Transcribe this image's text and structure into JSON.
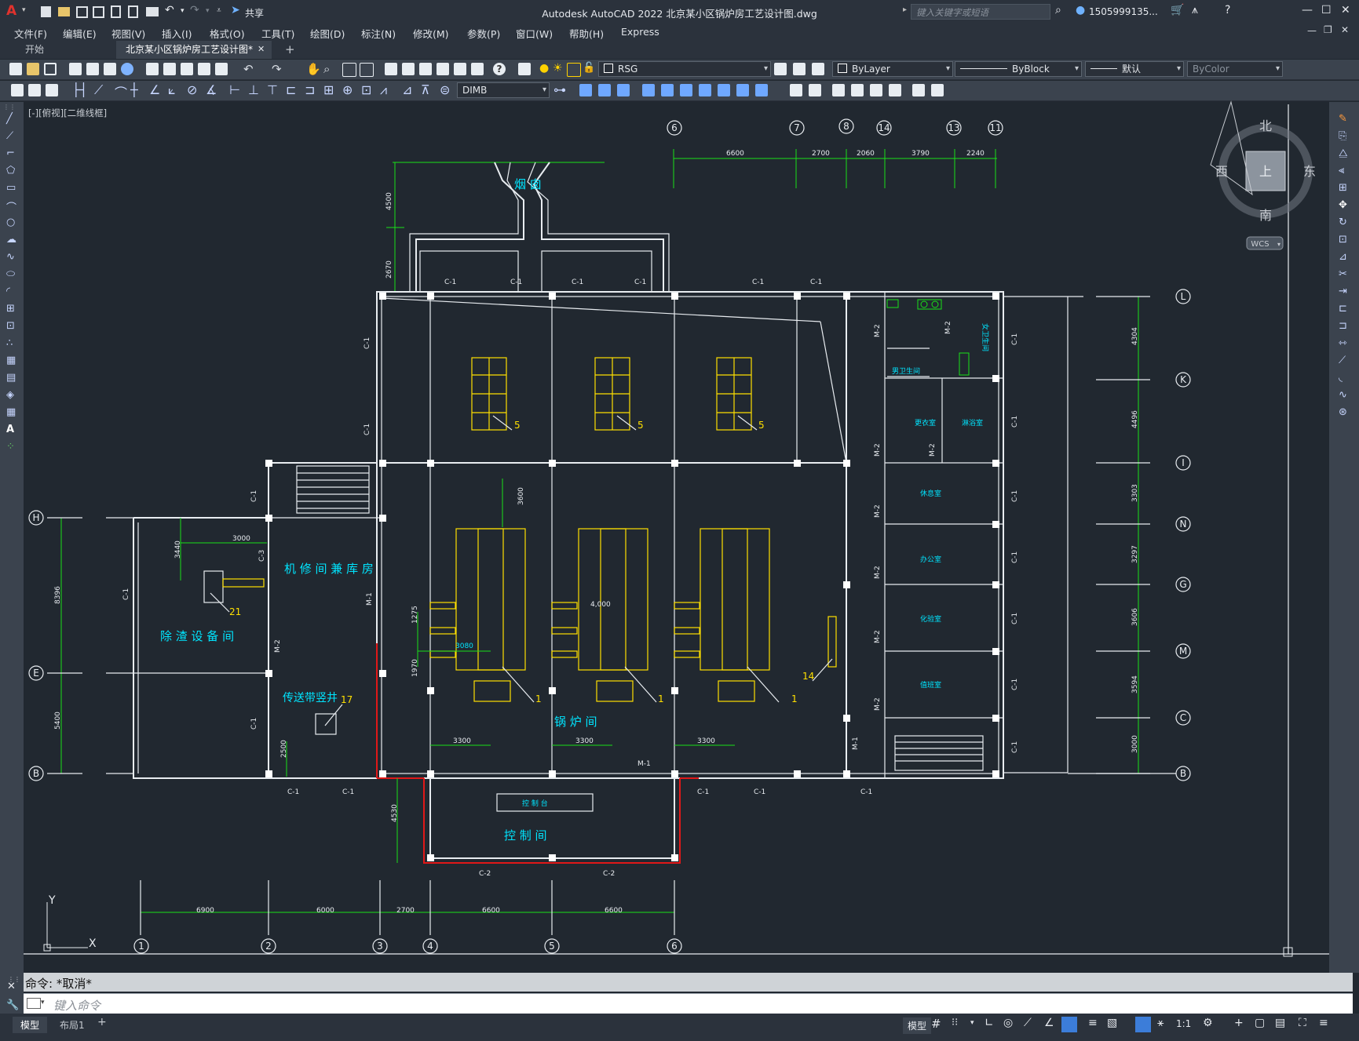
{
  "window": {
    "title": "Autodesk AutoCAD 2022    北京某小区锅炉房工艺设计图.dwg",
    "share_label": "共享",
    "search_placeholder": "键入关键字或短语",
    "user_name": "1505999135...",
    "min_label": "—",
    "max_label": "☐",
    "close_label": "✕"
  },
  "menu": {
    "items": [
      "文件(F)",
      "编辑(E)",
      "视图(V)",
      "插入(I)",
      "格式(O)",
      "工具(T)",
      "绘图(D)",
      "标注(N)",
      "修改(M)",
      "参数(P)",
      "窗口(W)",
      "帮助(H)",
      "Express"
    ]
  },
  "tabs": {
    "start": "开始",
    "active": "北京某小区锅炉房工艺设计图*",
    "close": "✕",
    "add": "+"
  },
  "toolbar": {
    "layer_value": "RSG",
    "color_value": "ByLayer",
    "linetype_value": "ByBlock",
    "lineweight_value": "默认",
    "plotstyle_value": "ByColor",
    "dimstyle_value": "DIMB"
  },
  "viewport": {
    "label": "[-][俯视][二维线框]",
    "compass": {
      "n": "北",
      "s": "南",
      "e": "东",
      "w": "西",
      "top": "上"
    },
    "wcs": "WCS",
    "ucs_y": "Y",
    "ucs_x": "X"
  },
  "drawing": {
    "top_axes": [
      "6",
      "7",
      "8",
      "14",
      "13",
      "11"
    ],
    "top_dims": [
      "6600",
      "2700",
      "2060",
      "3790",
      "2240"
    ],
    "bottom_axes": [
      "1",
      "2",
      "3",
      "4",
      "5",
      "6"
    ],
    "bottom_dims": [
      "6900",
      "6000",
      "2700",
      "6600",
      "6600"
    ],
    "left_axes": [
      "H",
      "E",
      "B"
    ],
    "left_dims": [
      "8396",
      "5400"
    ],
    "right_axes": [
      "L",
      "K",
      "I",
      "N",
      "G",
      "M",
      "C",
      "B"
    ],
    "right_dims": [
      "4304",
      "4496",
      "3303",
      "3297",
      "3606",
      "3594",
      "3000"
    ],
    "rooms": {
      "chimney": "烟 囱",
      "workshop": "机 修 间 兼 库 房",
      "dust_room": "除 渣 设 备 间",
      "conveyor": "传送带竖井",
      "boiler_room": "锅    炉    间",
      "control_room": "控     制     间",
      "console": "控  制  台",
      "changing": "更衣室",
      "bath": "淋浴室",
      "rest": "休息室",
      "office": "办公室",
      "lab": "化验室",
      "duty": "值班室",
      "toilet": "男卫生间",
      "toilet_f": "女卫生间"
    },
    "tags": {
      "c1": "C-1",
      "c2": "C-2",
      "c3": "C-3",
      "m1": "M-1",
      "m2": "M-2",
      "n5": "5",
      "n1": "1",
      "n14": "14",
      "n17": "17",
      "n21": "21",
      "d3000": "3000",
      "d3440": "3440",
      "d3300": "3300",
      "d4500": "4500",
      "d2670": "2670",
      "d3600": "3600",
      "d1275": "1275",
      "d3080": "3080",
      "d1970": "1970",
      "d2500": "2500",
      "d4000": "4,000",
      "d4530": "4530"
    }
  },
  "command": {
    "history": "命令: *取消*",
    "placeholder": "键入命令"
  },
  "status": {
    "tab_model": "模型",
    "tab_layout": "布局1",
    "tab_add": "+",
    "model_btn": "模型",
    "scale": "1:1"
  }
}
